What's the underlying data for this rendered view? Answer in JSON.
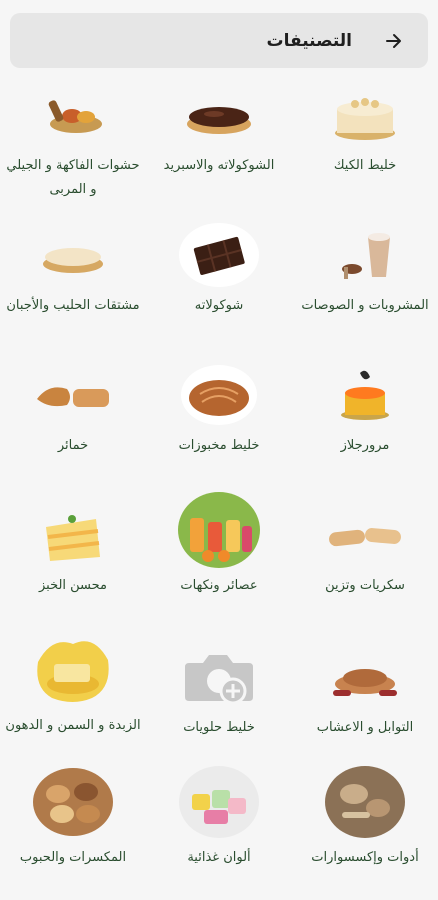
{
  "header": {
    "title": "التصنيفات",
    "back_icon": "arrow-right-icon"
  },
  "categories": [
    {
      "label": "خليط الكيك",
      "icon": "cheesecake-icon"
    },
    {
      "label": "الشوكولاته والاسبريد",
      "icon": "chocolate-tart-icon"
    },
    {
      "label": "حشوات الفاكهة و الجيلي و المربى",
      "icon": "fruit-filling-icon"
    },
    {
      "label": "المشروبات و الصوصات",
      "icon": "drinks-icon"
    },
    {
      "label": "شوكولاته",
      "icon": "chocolate-bar-icon"
    },
    {
      "label": "مشتقات الحليب والأجبان",
      "icon": "dairy-tart-icon"
    },
    {
      "label": "مرورجلاز",
      "icon": "mirror-glaze-cake-icon"
    },
    {
      "label": "خليط مخبوزات",
      "icon": "bread-loaf-icon"
    },
    {
      "label": "خمائر",
      "icon": "croissant-icon"
    },
    {
      "label": "سكريات وتزين",
      "icon": "sponge-fingers-icon"
    },
    {
      "label": "عصائر ونكهات",
      "icon": "juices-icon"
    },
    {
      "label": "محسن الخبز",
      "icon": "layer-cake-icon"
    },
    {
      "label": "التوابل و الاعشاب",
      "icon": "spices-icon"
    },
    {
      "label": "خليط حلويات",
      "icon": "add-image-placeholder-icon"
    },
    {
      "label": "الزبدة و السمن و الدهون",
      "icon": "butter-icon"
    },
    {
      "label": "أدوات وإكسسوارات",
      "icon": "tools-icon"
    },
    {
      "label": "ألوان غذائية",
      "icon": "food-colors-icon"
    },
    {
      "label": "المكسرات والحبوب",
      "icon": "nuts-icon"
    }
  ]
}
